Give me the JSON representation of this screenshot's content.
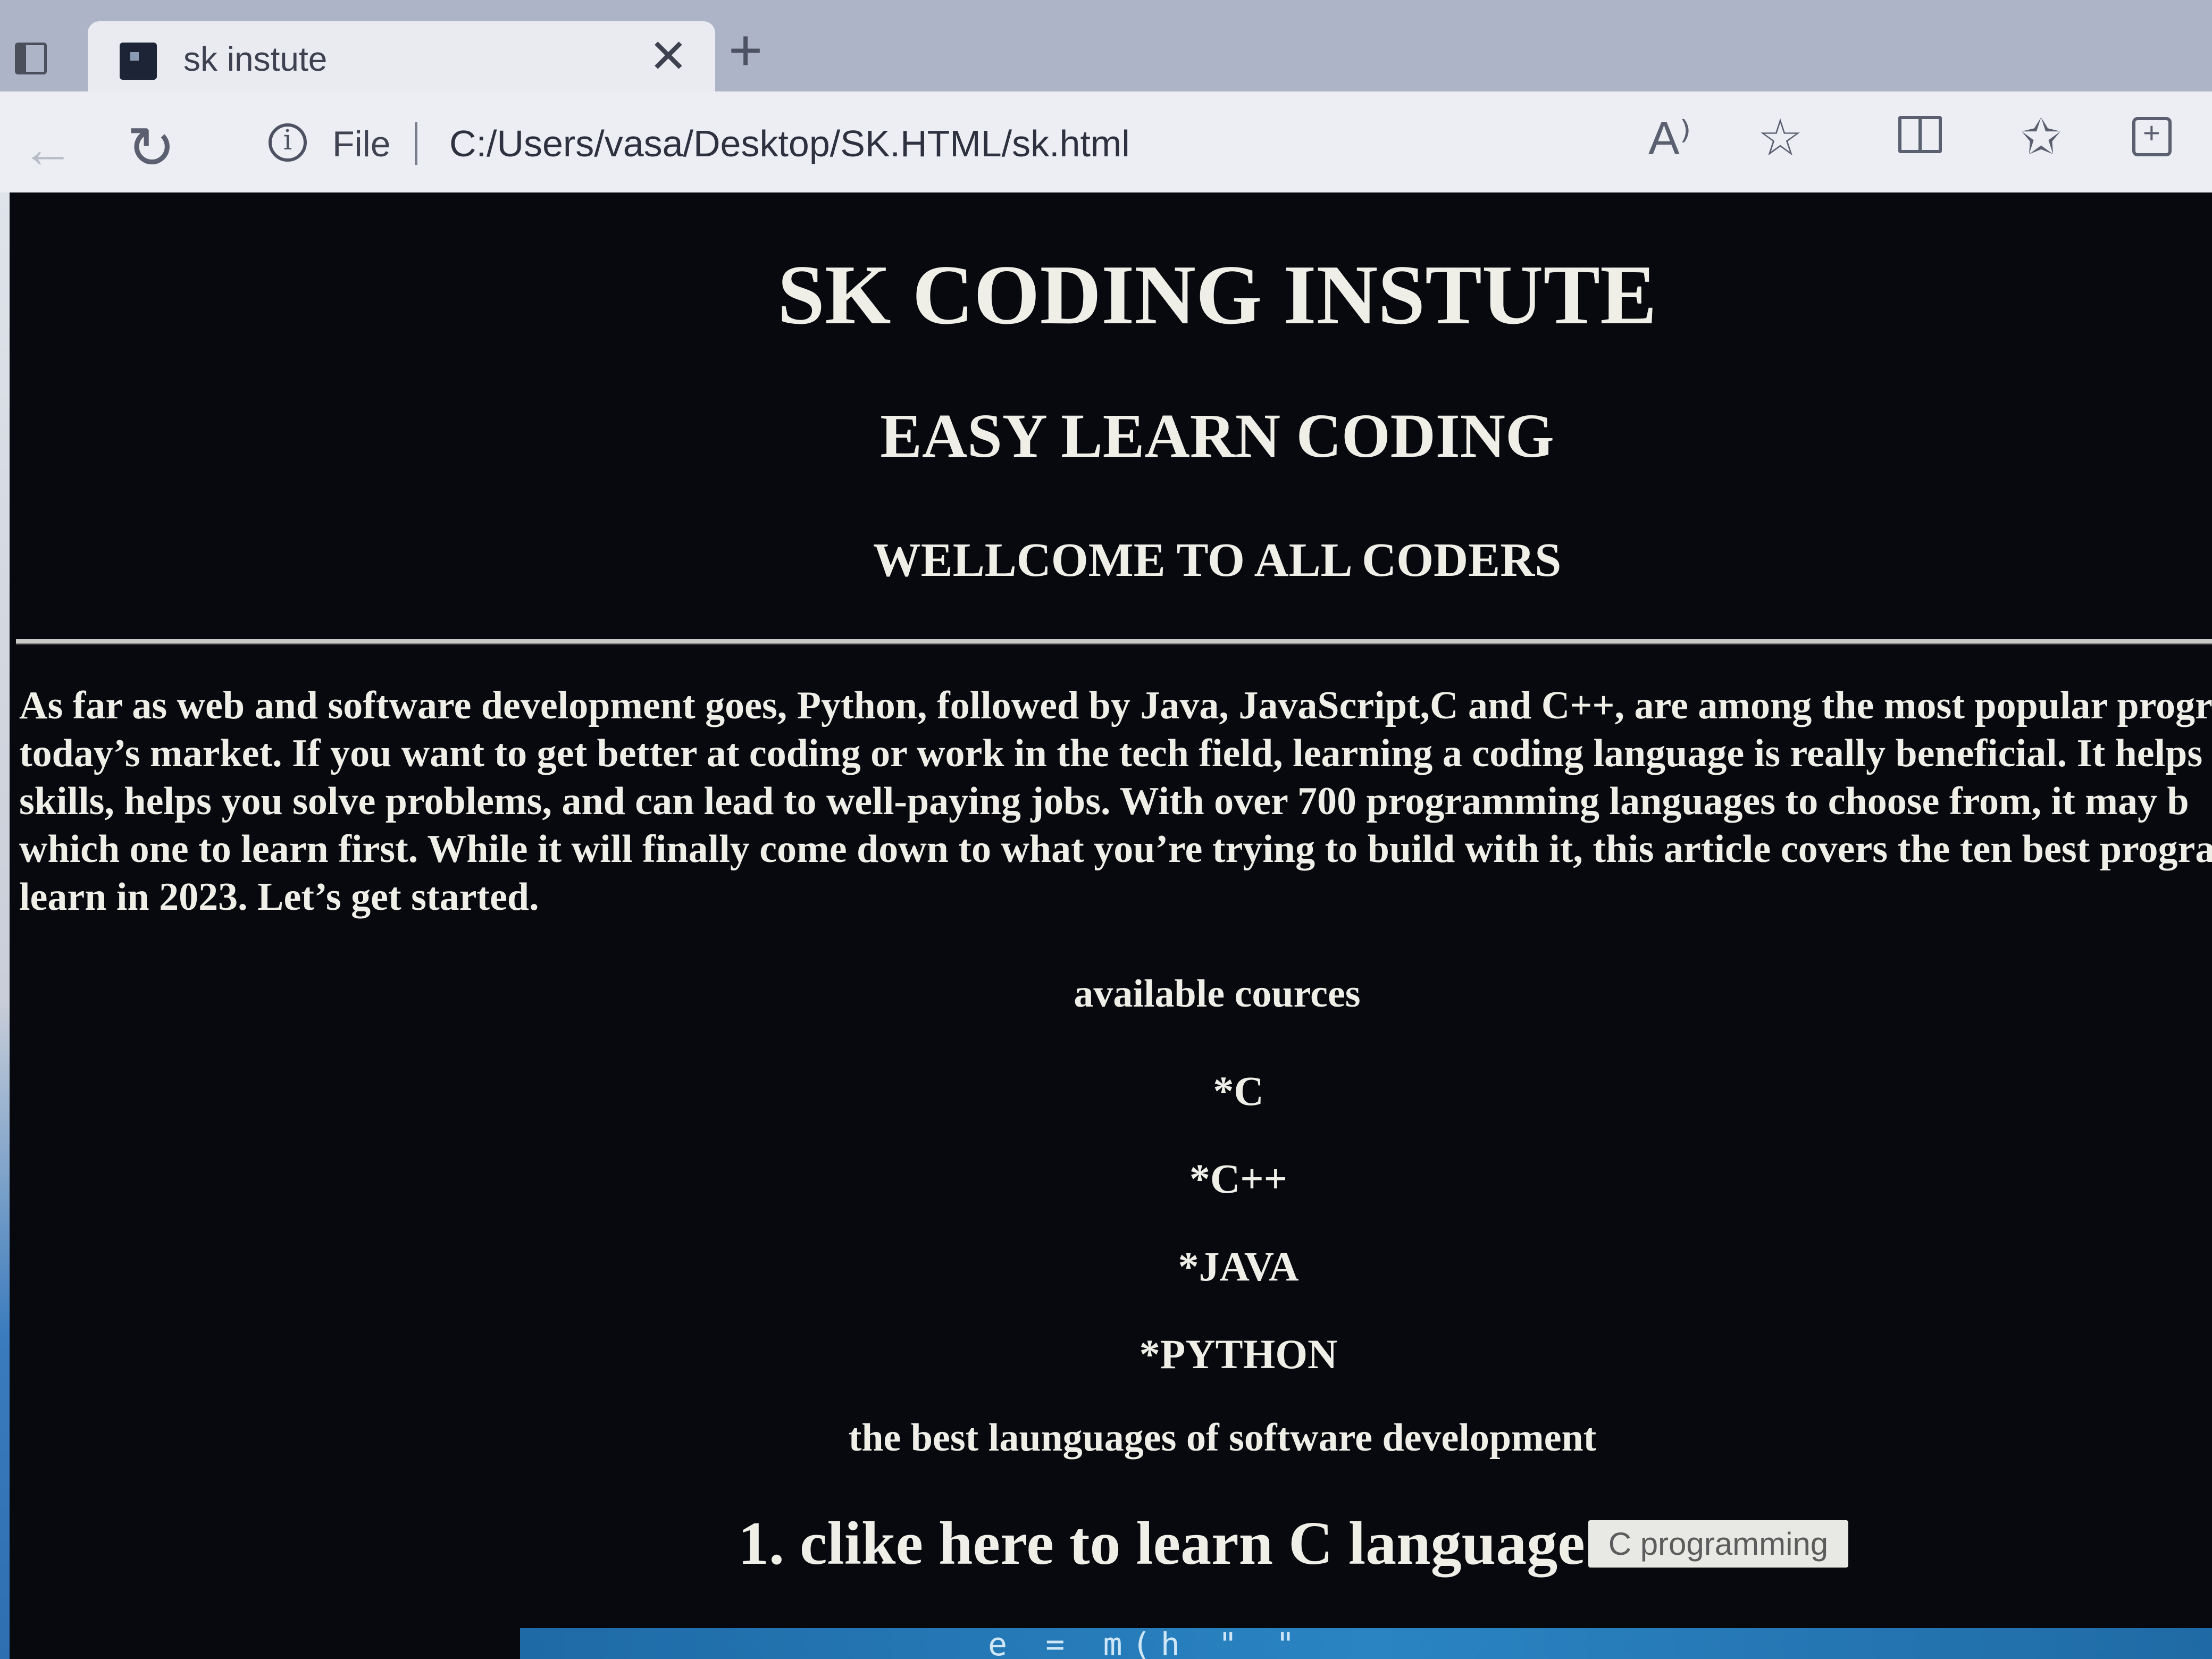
{
  "tab": {
    "title": "sk instute",
    "close": "✕"
  },
  "new_tab": "+",
  "toolbar": {
    "file_label": "File",
    "address": "C:/Users/vasa/Desktop/SK.HTML/sk.html",
    "read_aloud": "A⁾"
  },
  "page": {
    "h1": "SK CODING INSTUTE",
    "h2": "EASY LEARN CODING",
    "h3": "WELLCOME TO ALL CODERS",
    "paragraph_lines": [
      "As far as web and software development goes, Python, followed by Java, JavaScript,C and C++, are among the most popular progr",
      "today’s market. If you want to get better at coding or work in the tech field, learning a coding language is really beneficial. It helps",
      "skills, helps you solve problems, and can lead to well-paying jobs. With over 700 programming languages to choose from, it may b",
      "which one to learn first. While it will finally come down to what you’re trying to build with it, this article covers the ten best progra",
      "learn in 2023. Let’s get started."
    ],
    "courses_heading": "available cources",
    "courses": [
      "*C",
      "*C++",
      "*JAVA",
      "*PYTHON"
    ],
    "subtitle": "the best launguages of software development",
    "link_heading": "1. clike here to learn C language",
    "c_button": "C programming"
  }
}
